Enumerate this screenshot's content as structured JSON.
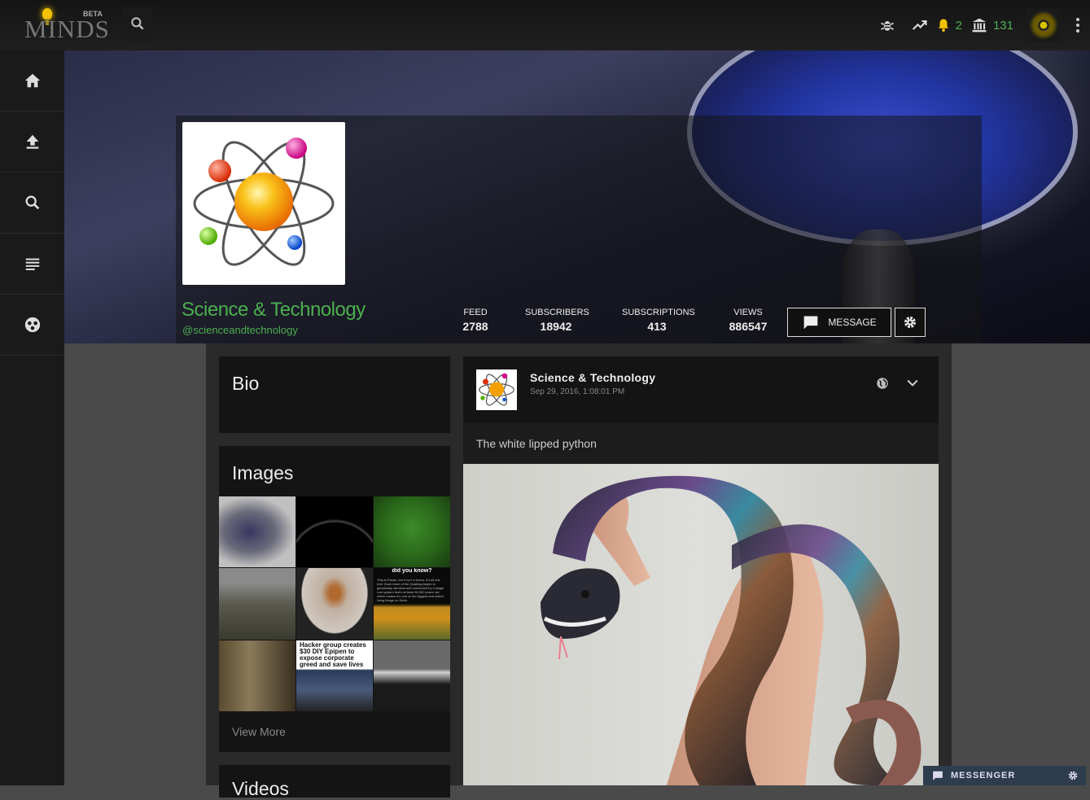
{
  "app": {
    "logo_text": "MINDS",
    "beta_label": "BETA"
  },
  "topbar": {
    "notifications_count": "2",
    "points_count": "131",
    "icons": [
      "search-icon",
      "bug-icon",
      "trending-icon",
      "bell-icon",
      "bank-icon",
      "more-vert-icon"
    ]
  },
  "sidebar": {
    "items": [
      {
        "icon": "home-icon"
      },
      {
        "icon": "upload-icon"
      },
      {
        "icon": "search-icon"
      },
      {
        "icon": "newsfeed-icon"
      },
      {
        "icon": "groups-icon"
      }
    ]
  },
  "profile": {
    "name": "Science & Technology",
    "handle": "@scienceandtechnology",
    "stats": [
      {
        "label": "FEED",
        "value": "2788"
      },
      {
        "label": "SUBSCRIBERS",
        "value": "18942"
      },
      {
        "label": "SUBSCRIPTIONS",
        "value": "413"
      },
      {
        "label": "VIEWS",
        "value": "886547"
      }
    ],
    "message_button": "MESSAGE"
  },
  "bio": {
    "title": "Bio"
  },
  "images": {
    "title": "Images",
    "view_more": "View More",
    "thumb_texts": {
      "did_you_know": "did you know?",
      "aspen": "This is Pando, but it isn't a forest- it's all one tree. Each trunk of the Quaking Aspen is genetically identical and connected by a single root system that's at least 80,000 years old, which means it's one of the biggest and oldest living things on Earth.",
      "hacker": "Hacker group creates $30 DIY Epipen to expose corporate greed and save lives"
    }
  },
  "videos": {
    "title": "Videos"
  },
  "post": {
    "author": "Science & Technology",
    "date": "Sep 29, 2016, 1:08:01 PM",
    "text": "The white lipped python"
  },
  "messenger": {
    "label": "MESSENGER"
  },
  "colors": {
    "accent": "#4caf50",
    "bell": "#f2c200"
  }
}
